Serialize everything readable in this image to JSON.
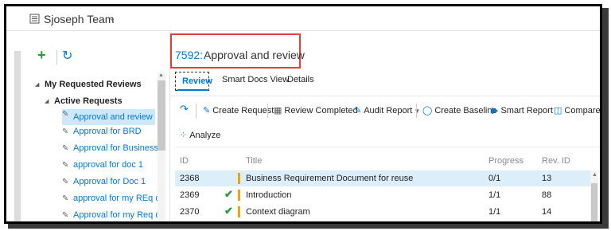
{
  "header": {
    "team_name": "Sjoseph Team"
  },
  "sidebar": {
    "section_title": "My Requested Reviews",
    "group_title": "Active Requests",
    "items": [
      {
        "label": "Approval and review"
      },
      {
        "label": "Approval for BRD"
      },
      {
        "label": "Approval for Business Re..."
      },
      {
        "label": "approval for doc 1"
      },
      {
        "label": "Approval for Doc 1"
      },
      {
        "label": "approval for my REq doc"
      },
      {
        "label": "Approval for my Req do..."
      }
    ]
  },
  "main": {
    "work_item_id": "7592:",
    "work_item_title": "Approval and review",
    "tabs": [
      {
        "label": "Review"
      },
      {
        "label": "Smart Docs View"
      },
      {
        "label": "Details"
      }
    ],
    "toolbar": {
      "create_request": "Create Request",
      "review_completed": "Review Completed",
      "audit_report": "Audit Report",
      "create_baseline": "Create Baseline",
      "smart_report": "Smart Report",
      "compare": "Compare",
      "analyze": "Analyze"
    },
    "grid": {
      "columns": {
        "id": "ID",
        "title": "Title",
        "progress": "Progress",
        "rev_id": "Rev. ID"
      },
      "rows": [
        {
          "id": "2368",
          "title": "Business Requirement Document for reuse",
          "progress": "0/1",
          "rev_id": "13"
        },
        {
          "id": "2369",
          "title": "Introduction",
          "progress": "1/1",
          "rev_id": "88"
        },
        {
          "id": "2370",
          "title": "Context diagram",
          "progress": "1/1",
          "rev_id": "14"
        }
      ]
    }
  },
  "colors": {
    "accent": "#0078d4",
    "success": "#2a9b3b",
    "highlight_border": "#e0403c",
    "status_bar": "#f2a20a"
  }
}
